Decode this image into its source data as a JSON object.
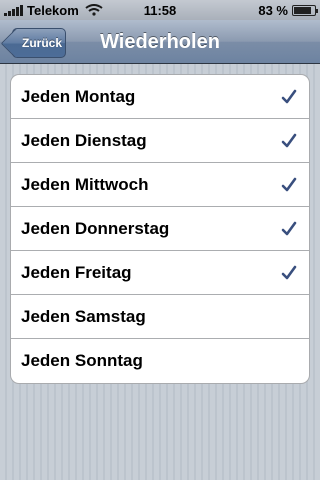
{
  "status_bar": {
    "carrier": "Telekom",
    "time": "11:58",
    "battery_percent_label": "83 %",
    "battery_level": 0.83
  },
  "nav": {
    "back_label": "Zurück",
    "title": "Wiederholen"
  },
  "days": [
    {
      "label": "Jeden Montag",
      "checked": true
    },
    {
      "label": "Jeden Dienstag",
      "checked": true
    },
    {
      "label": "Jeden Mittwoch",
      "checked": true
    },
    {
      "label": "Jeden Donnerstag",
      "checked": true
    },
    {
      "label": "Jeden Freitag",
      "checked": true
    },
    {
      "label": "Jeden Samstag",
      "checked": false
    },
    {
      "label": "Jeden Sonntag",
      "checked": false
    }
  ],
  "colors": {
    "checkmark": "#394f7e"
  }
}
